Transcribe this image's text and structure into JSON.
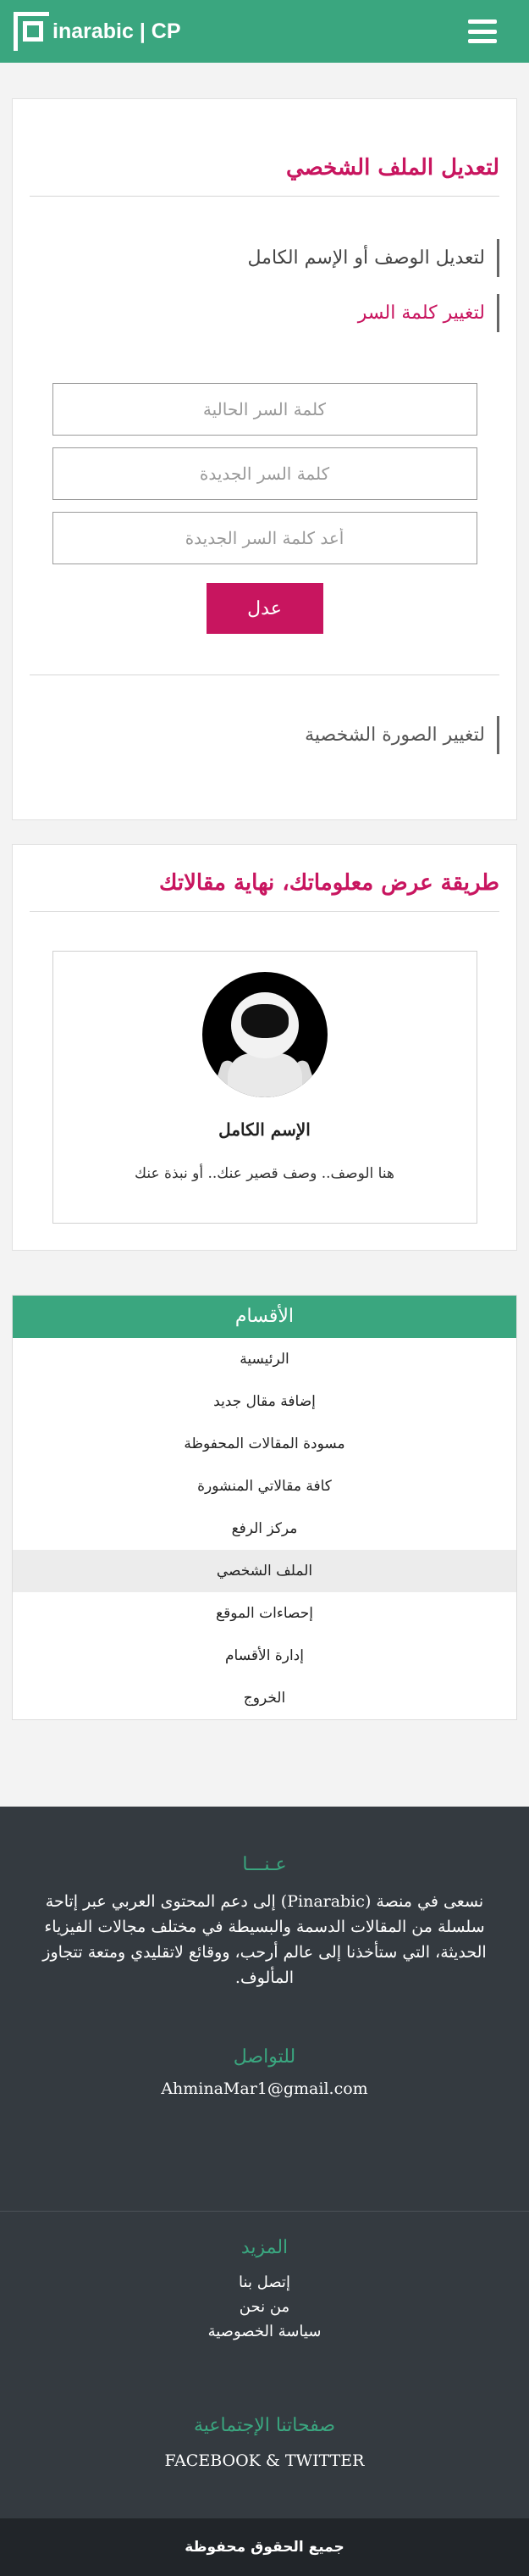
{
  "header": {
    "brand": "inarabic | CP"
  },
  "edit_profile": {
    "title": "لتعديل الملف الشخصي",
    "edit_name_label": "لتعديل الوصف أو الإسم الكامل",
    "change_password_label": "لتغيير كلمة السر",
    "current_password_placeholder": "كلمة السر الحالية",
    "new_password_placeholder": "كلمة السر الجديدة",
    "repeat_password_placeholder": "أعد كلمة السر الجديدة",
    "submit_label": "عدل",
    "change_photo_label": "لتغيير الصورة الشخصية"
  },
  "display_info": {
    "title": "طريقة عرض معلوماتك، نهاية مقالاتك",
    "full_name": "الإسم الكامل",
    "description": "هنا الوصف.. وصف قصير عنك.. أو نبذة عنك"
  },
  "categories": {
    "title": "الأقسام",
    "items": [
      {
        "label": "الرئيسية",
        "active": false
      },
      {
        "label": "إضافة مقال جديد",
        "active": false
      },
      {
        "label": "مسودة المقالات المحفوظة",
        "active": false
      },
      {
        "label": "كافة مقالاتي المنشورة",
        "active": false
      },
      {
        "label": "مركز الرفع",
        "active": false
      },
      {
        "label": "الملف الشخصي",
        "active": true
      },
      {
        "label": "إحصاءات الموقع",
        "active": false
      },
      {
        "label": "إدارة الأقسام",
        "active": false
      },
      {
        "label": "الخروج",
        "active": false
      }
    ]
  },
  "footer": {
    "about_title": "عـنـــا",
    "about_text": "نسعى في منصة (Pinarabic) إلى دعم المحتوى العربي عبر إتاحة سلسلة من المقالات الدسمة والبسيطة في مختلف مجالات الفيزياء الحديثة، التي ستأخذنا إلى عالم أرحب، ووقائع لاتقليدي ومتعة تتجاوز المألوف.",
    "contact_title": "للتواصل",
    "email": "AhminaMar1@gmail.com",
    "more_title": "المزيد",
    "links": [
      "إتصل بنا",
      "من نحن",
      "سياسة الخصوصية"
    ],
    "social_title": "صفحاتنا الإجتماعية",
    "social": "FACEBOOK & TWITTER",
    "copyright": "جميع الحقوق محفوظة"
  },
  "colors": {
    "accent": "#3aa67f",
    "brand_pink": "#c8155f",
    "footer_dark": "#343a40"
  }
}
